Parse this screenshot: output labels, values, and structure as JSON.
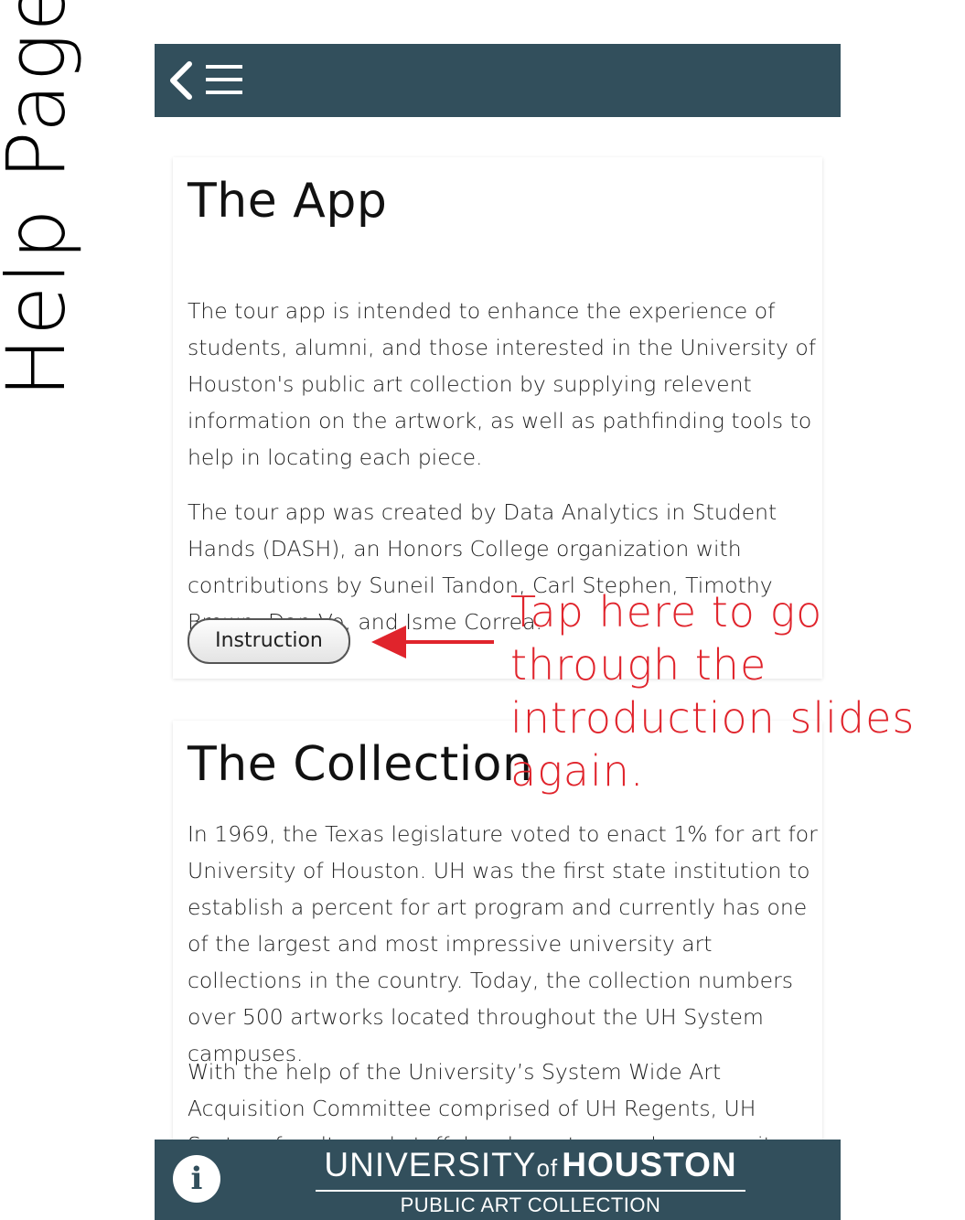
{
  "side_label": "Help Page",
  "header": {
    "back_icon": "chevron-left-icon",
    "menu_icon": "hamburger-menu-icon"
  },
  "sections": {
    "app": {
      "title": "The App",
      "paragraph1": "The tour app is intended to enhance the experience of students, alumni, and those interested in the University of Houston's public art collection by supplying relevent information on the artwork, as well as pathfinding tools to help in locating each piece.",
      "paragraph2": "The tour app was created by Data Analytics in Student Hands (DASH), an Honors College organization with contributions by Suneil Tandon, Carl Stephen, Timothy Brown, Dan Vo, and Isme Correa.",
      "button_label": "Instruction"
    },
    "collection": {
      "title": "The Collection",
      "paragraph1": "In 1969, the Texas legislature voted to enact 1% for art for University of Houston. UH was the first state institution to establish a percent for art program and currently has one of the largest and most impressive university art collections in the country. Today, the collection numbers over 500 artworks located throughout the UH System campuses.",
      "paragraph2": "With the help of the University’s System Wide Art Acquisition Committee comprised of UH Regents, UH System faculty and staff, local curators and community representatives, the"
    }
  },
  "annotation": {
    "text": "Tap here to go through the introduction slides again.",
    "color": "#e0242c"
  },
  "footer": {
    "info_label": "i",
    "brand_university": "UNIVERSITY",
    "brand_of": "of",
    "brand_houston": "HOUSTON",
    "brand_subtitle": "PUBLIC ART COLLECTION"
  },
  "colors": {
    "bar_background": "#324f5c",
    "page_background": "#ffffff"
  }
}
